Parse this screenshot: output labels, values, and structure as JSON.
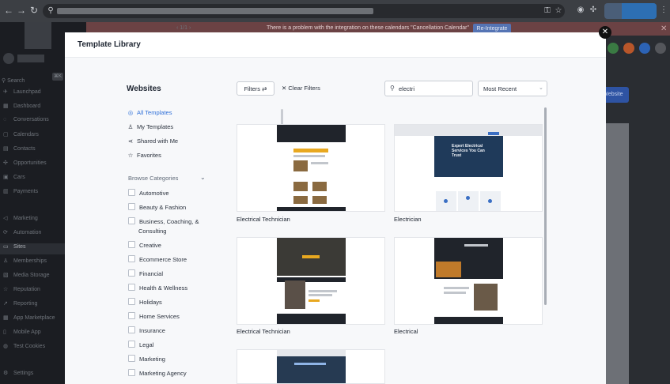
{
  "browser": {
    "toolbar_icons": [
      "back-icon",
      "forward-icon",
      "reload-icon",
      "site-info-icon",
      "key-icon",
      "star-icon",
      "extension-icon",
      "puzzle-icon",
      "menu-icon"
    ]
  },
  "app": {
    "pager": "‹  1/1  ›",
    "search_placeholder": "Search",
    "search_shortcut": "⌘K",
    "banner_text": "There is a problem with the integration on these calendars \"Cancellation Calendar\"",
    "banner_button": "Re-Integrate",
    "create_button": "Website",
    "sidebar": [
      {
        "icon": "rocket-icon",
        "label": "Launchpad"
      },
      {
        "icon": "dashboard-icon",
        "label": "Dashboard"
      },
      {
        "icon": "chat-icon",
        "label": "Conversations"
      },
      {
        "icon": "calendar-icon",
        "label": "Calendars"
      },
      {
        "icon": "contacts-icon",
        "label": "Contacts"
      },
      {
        "icon": "opportunities-icon",
        "label": "Opportunities"
      },
      {
        "icon": "box-icon",
        "label": "Cars"
      },
      {
        "icon": "payments-icon",
        "label": "Payments"
      },
      {
        "icon": "megaphone-icon",
        "label": "Marketing"
      },
      {
        "icon": "automation-icon",
        "label": "Automation"
      },
      {
        "icon": "sites-icon",
        "label": "Sites"
      },
      {
        "icon": "members-icon",
        "label": "Memberships"
      },
      {
        "icon": "media-icon",
        "label": "Media Storage"
      },
      {
        "icon": "star-icon",
        "label": "Reputation"
      },
      {
        "icon": "reporting-icon",
        "label": "Reporting"
      },
      {
        "icon": "marketplace-icon",
        "label": "App Marketplace"
      },
      {
        "icon": "mobile-icon",
        "label": "Mobile App"
      },
      {
        "icon": "cookie-icon",
        "label": "Test Cookies"
      },
      {
        "icon": "settings-icon",
        "label": "Settings"
      }
    ],
    "active_item": "Sites"
  },
  "modal": {
    "title": "Template Library",
    "nav_title": "Websites",
    "nav": [
      {
        "icon": "check-circle-icon",
        "label": "All Templates",
        "active": true
      },
      {
        "icon": "user-icon",
        "label": "My Templates",
        "active": false
      },
      {
        "icon": "share-icon",
        "label": "Shared with Me",
        "active": false
      },
      {
        "icon": "star-icon",
        "label": "Favorites",
        "active": false
      }
    ],
    "browse_label": "Browse Categories",
    "categories": [
      "Automotive",
      "Beauty & Fashion",
      "Business, Coaching, &",
      "Creative",
      "Ecommerce Store",
      "Financial",
      "Health & Wellness",
      "Holidays",
      "Home Services",
      "Insurance",
      "Legal",
      "Marketing",
      "Marketing Agency"
    ],
    "category_continuation": "Consulting",
    "filters_label": "Filters",
    "clear_filters_label": "Clear Filters",
    "search_value": "electri",
    "sort_value": "Most Recent",
    "templates": [
      {
        "name": "Electrical Technician"
      },
      {
        "name": "Electrician"
      },
      {
        "name": "Electrical Technician"
      },
      {
        "name": "Electrical"
      },
      {
        "name": ""
      }
    ],
    "thumb_text": {
      "t2_hero": "Expert Electrical Services You Can Trust"
    }
  },
  "colors": {
    "accent": "#2e6fd8",
    "banner": "#6b4244",
    "template_accent": "#e8a820"
  }
}
